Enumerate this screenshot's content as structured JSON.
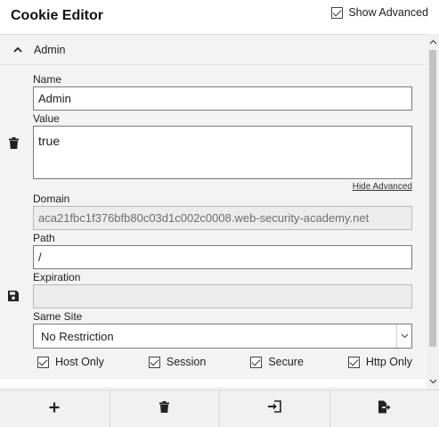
{
  "app": {
    "title": "Cookie Editor"
  },
  "toolbar": {
    "show_advanced_label": "Show Advanced",
    "show_advanced_checked": true
  },
  "cookie": {
    "name": "Admin",
    "fields": {
      "name_label": "Name",
      "name_value": "Admin",
      "value_label": "Value",
      "value_value": "true",
      "hide_advanced": "Hide Advanced",
      "domain_label": "Domain",
      "domain_value": "aca21fbc1f376bfb80c03d1c002c0008.web-security-academy.net",
      "path_label": "Path",
      "path_value": "/",
      "expiration_label": "Expiration",
      "expiration_value": "",
      "same_site_label": "Same Site",
      "same_site_value": "No Restriction"
    },
    "flags": {
      "host_only": {
        "label": "Host Only",
        "checked": true
      },
      "session": {
        "label": "Session",
        "checked": true
      },
      "secure": {
        "label": "Secure",
        "checked": true
      },
      "http_only": {
        "label": "Http Only",
        "checked": true
      }
    }
  },
  "icons": {
    "collapse": "chevron-up-icon",
    "delete_cookie": "trash-icon",
    "save_cookie": "floppy-disk-icon",
    "add": "plus-icon",
    "delete_all": "trash-icon",
    "import": "import-icon",
    "export": "export-icon"
  }
}
